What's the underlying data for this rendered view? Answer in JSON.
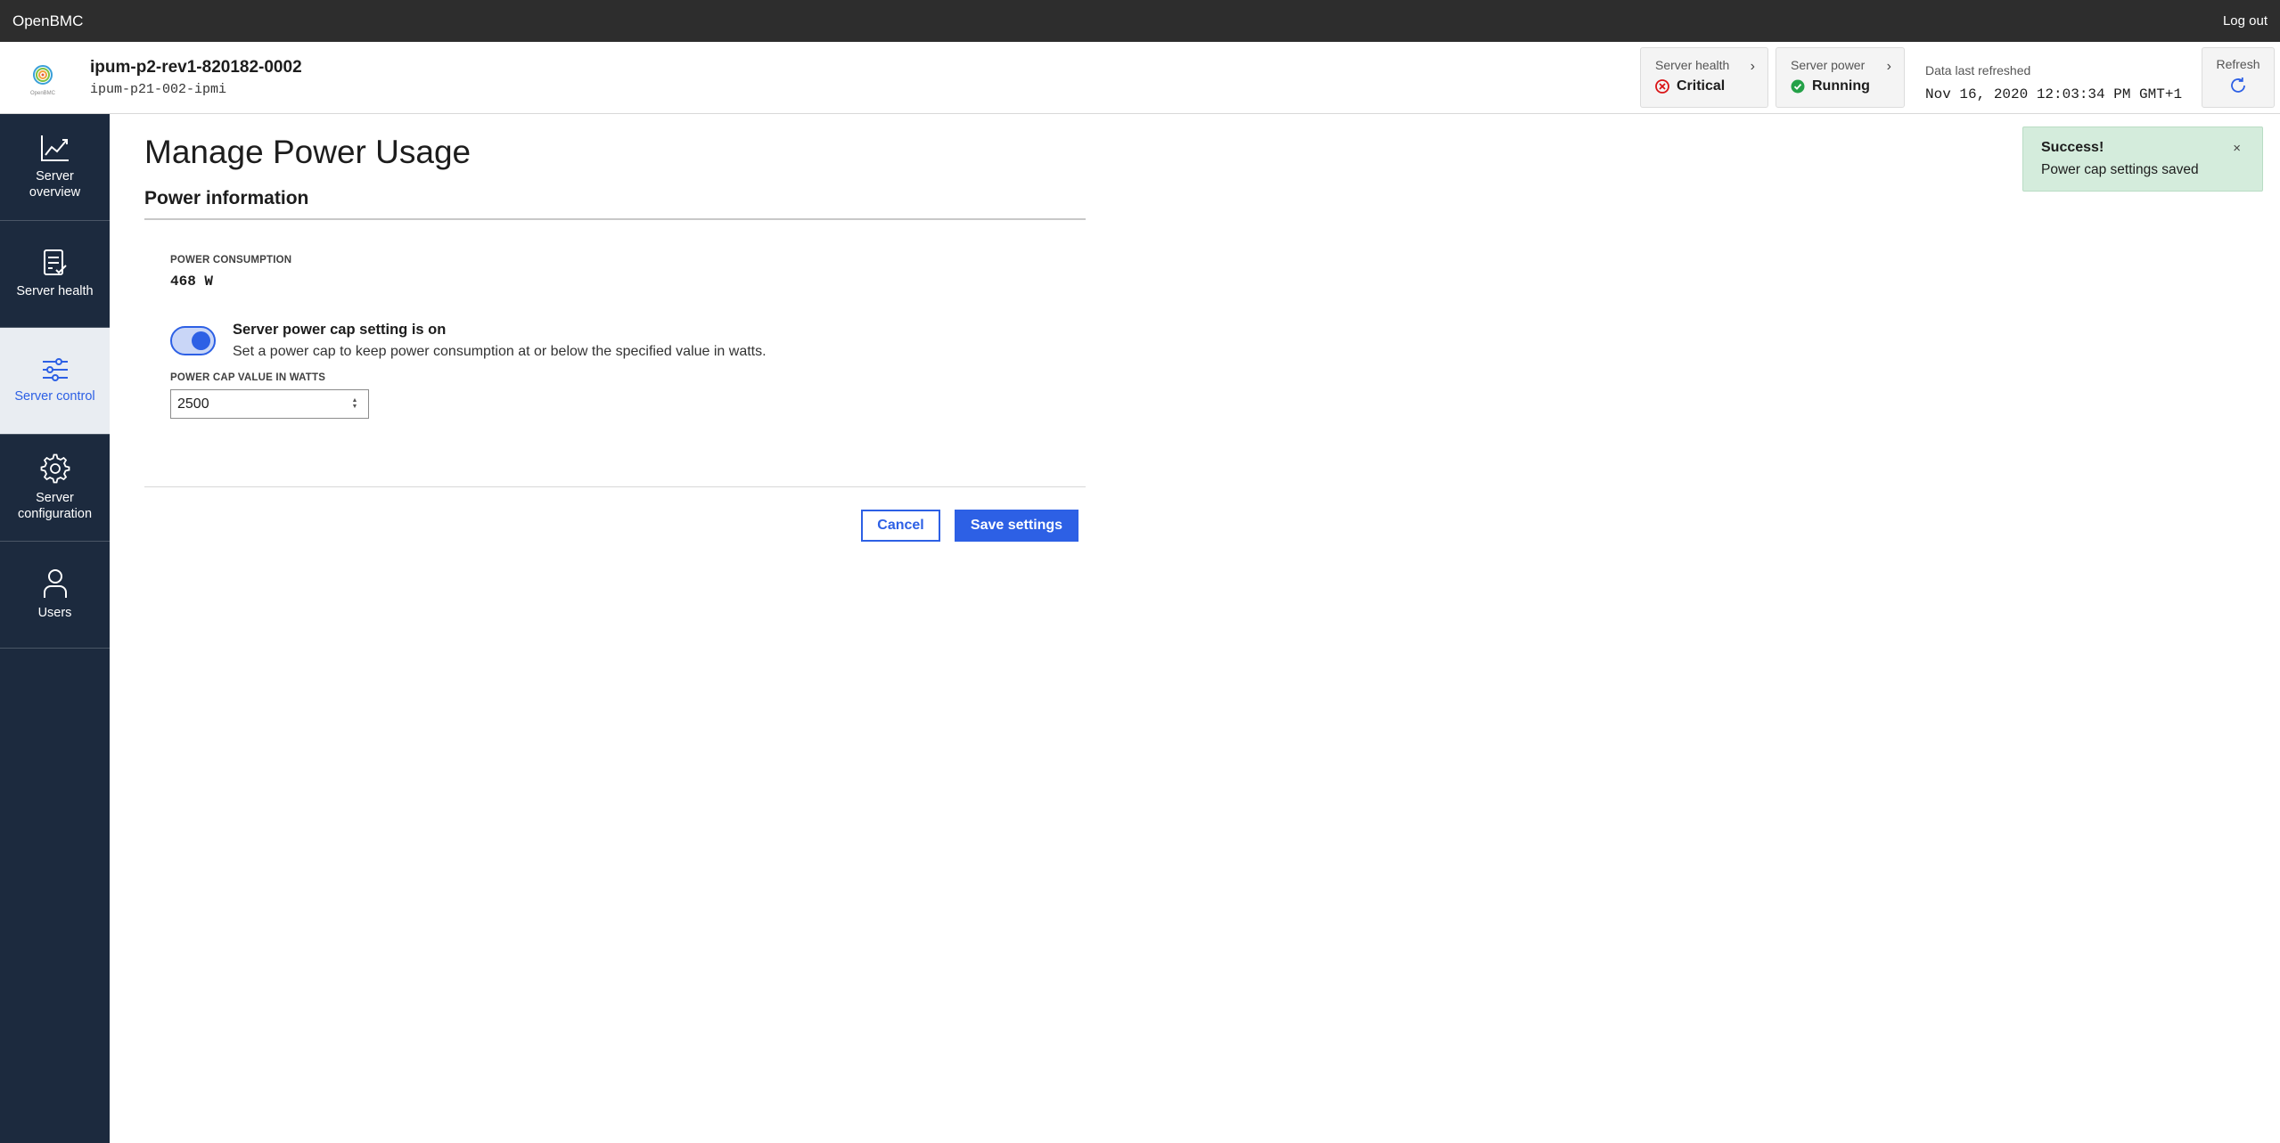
{
  "topbar": {
    "brand": "OpenBMC",
    "logout": "Log out"
  },
  "header": {
    "logo_text": "OpenBMC",
    "host_name": "ipum-p2-rev1-820182-0002",
    "host_sub": "ipum-p21-002-ipmi",
    "server_health": {
      "label": "Server health",
      "value": "Critical",
      "status_color": "#da1416"
    },
    "server_power": {
      "label": "Server power",
      "value": "Running",
      "status_color": "#0a7d32"
    },
    "last_refreshed": {
      "label": "Data last refreshed",
      "timestamp": "Nov 16, 2020 12:03:34 PM GMT+1"
    },
    "refresh_label": "Refresh"
  },
  "sidebar": {
    "items": [
      {
        "label": "Server overview",
        "icon": "chart-line-icon"
      },
      {
        "label": "Server health",
        "icon": "report-check-icon"
      },
      {
        "label": "Server control",
        "icon": "sliders-icon",
        "active": true
      },
      {
        "label": "Server configuration",
        "icon": "gear-icon"
      },
      {
        "label": "Users",
        "icon": "user-icon"
      }
    ]
  },
  "main": {
    "page_title": "Manage Power Usage",
    "section_title": "Power information",
    "power_consumption": {
      "label": "POWER CONSUMPTION",
      "value": "468 W"
    },
    "power_cap_toggle": {
      "title": "Server power cap setting is on",
      "description": "Set a power cap to keep power consumption at or below the specified value in watts.",
      "on": true
    },
    "power_cap_value": {
      "label": "POWER CAP VALUE IN WATTS",
      "value": "2500"
    },
    "buttons": {
      "cancel": "Cancel",
      "save": "Save settings"
    }
  },
  "toast": {
    "title": "Success!",
    "message": "Power cap settings saved",
    "close": "×"
  },
  "colors": {
    "accent": "#2d60e5",
    "sidebar_bg": "#1c2a3e",
    "topbar_bg": "#2d2d2d",
    "toast_bg": "#d4ecdc"
  }
}
